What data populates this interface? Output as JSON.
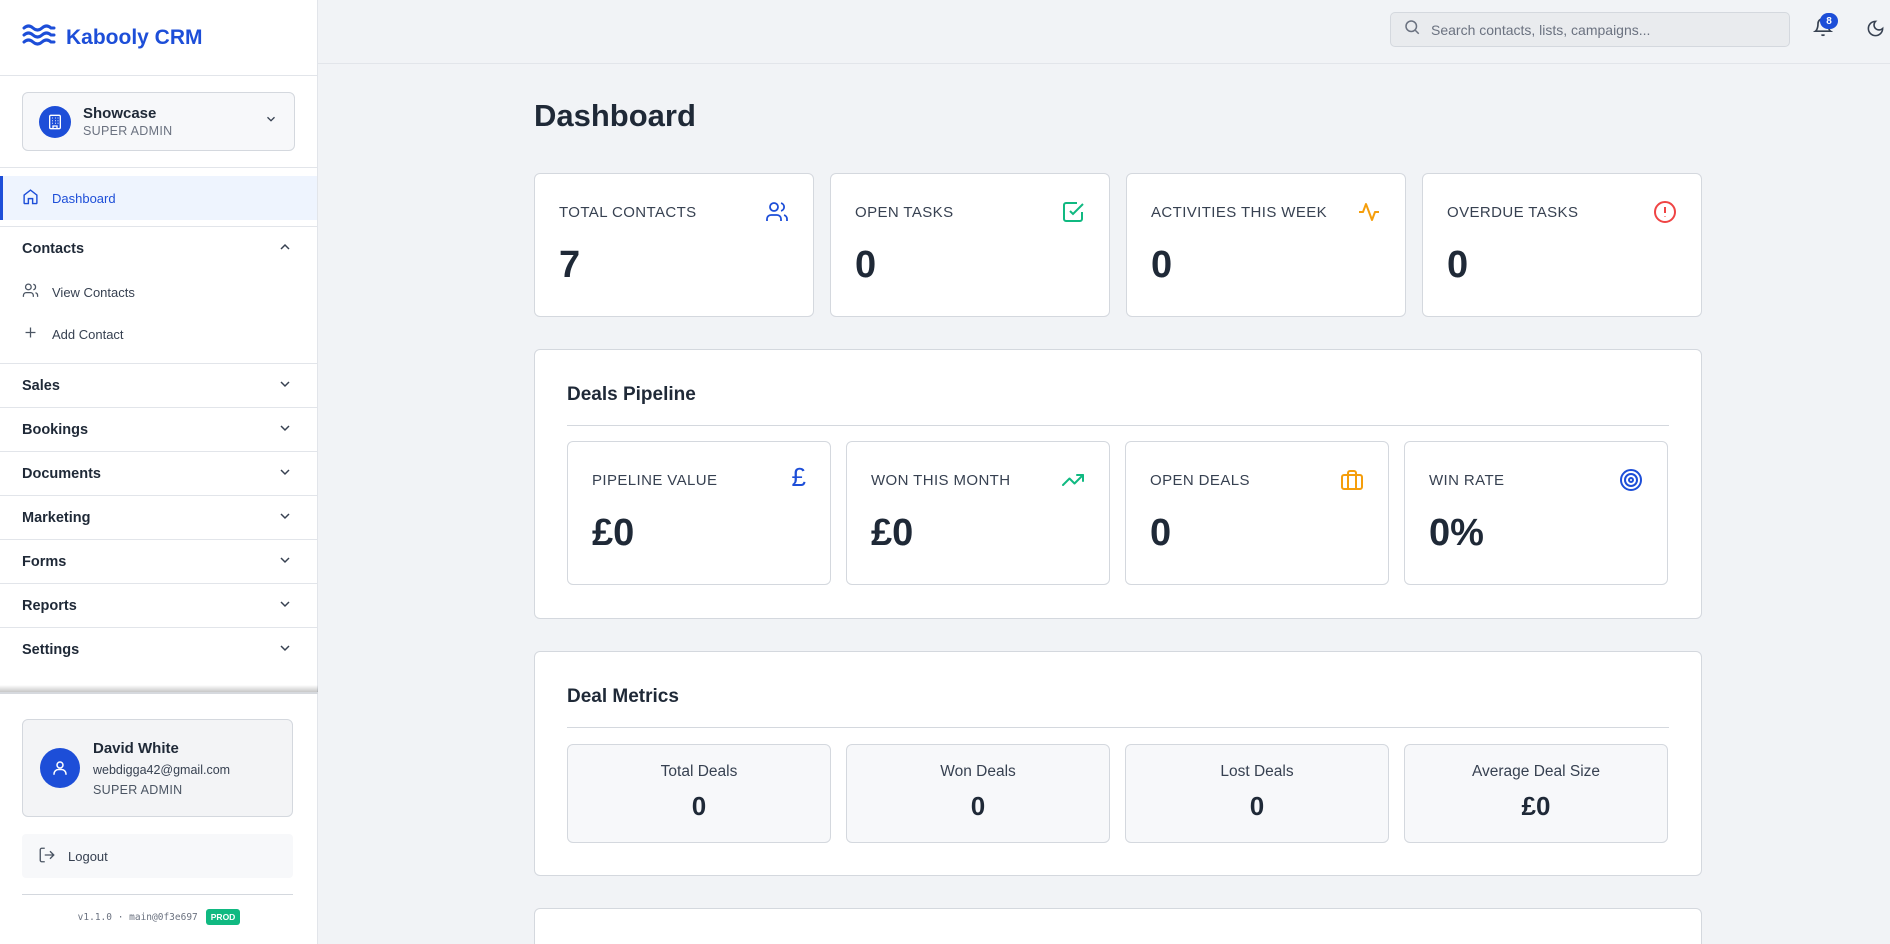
{
  "brand": {
    "name": "Kabooly CRM"
  },
  "org": {
    "name": "Showcase",
    "role": "SUPER ADMIN"
  },
  "nav": {
    "dashboard": "Dashboard",
    "contacts": {
      "label": "Contacts",
      "items": [
        "View Contacts",
        "Add Contact"
      ]
    },
    "groups": [
      "Sales",
      "Bookings",
      "Documents",
      "Marketing",
      "Forms",
      "Reports",
      "Settings"
    ]
  },
  "user": {
    "name": "David White",
    "email": "webdigga42@gmail.com",
    "role": "SUPER ADMIN"
  },
  "logout": "Logout",
  "version": {
    "text": "v1.1.0 · main@0f3e697",
    "env": "PROD"
  },
  "header": {
    "search_placeholder": "Search contacts, lists, campaigns...",
    "notifications": "8"
  },
  "page": {
    "title": "Dashboard"
  },
  "stats": [
    {
      "label": "TOTAL CONTACTS",
      "value": "7",
      "icon": "users-icon",
      "color": "#1d4ed8"
    },
    {
      "label": "OPEN TASKS",
      "value": "0",
      "icon": "check-square-icon",
      "color": "#10b981"
    },
    {
      "label": "ACTIVITIES THIS WEEK",
      "value": "0",
      "icon": "activity-icon",
      "color": "#f59e0b"
    },
    {
      "label": "OVERDUE TASKS",
      "value": "0",
      "icon": "alert-circle-icon",
      "color": "#ef4444"
    }
  ],
  "pipeline": {
    "title": "Deals Pipeline",
    "cards": [
      {
        "label": "PIPELINE VALUE",
        "value": "£0",
        "icon": "pound-icon",
        "color": "#1d4ed8"
      },
      {
        "label": "WON THIS MONTH",
        "value": "£0",
        "icon": "trending-up-icon",
        "color": "#10b981"
      },
      {
        "label": "OPEN DEALS",
        "value": "0",
        "icon": "briefcase-icon",
        "color": "#f59e0b"
      },
      {
        "label": "WIN RATE",
        "value": "0%",
        "icon": "target-icon",
        "color": "#1d4ed8"
      }
    ]
  },
  "metrics": {
    "title": "Deal Metrics",
    "cards": [
      {
        "label": "Total Deals",
        "value": "0"
      },
      {
        "label": "Won Deals",
        "value": "0"
      },
      {
        "label": "Lost Deals",
        "value": "0"
      },
      {
        "label": "Average Deal Size",
        "value": "£0"
      }
    ]
  }
}
